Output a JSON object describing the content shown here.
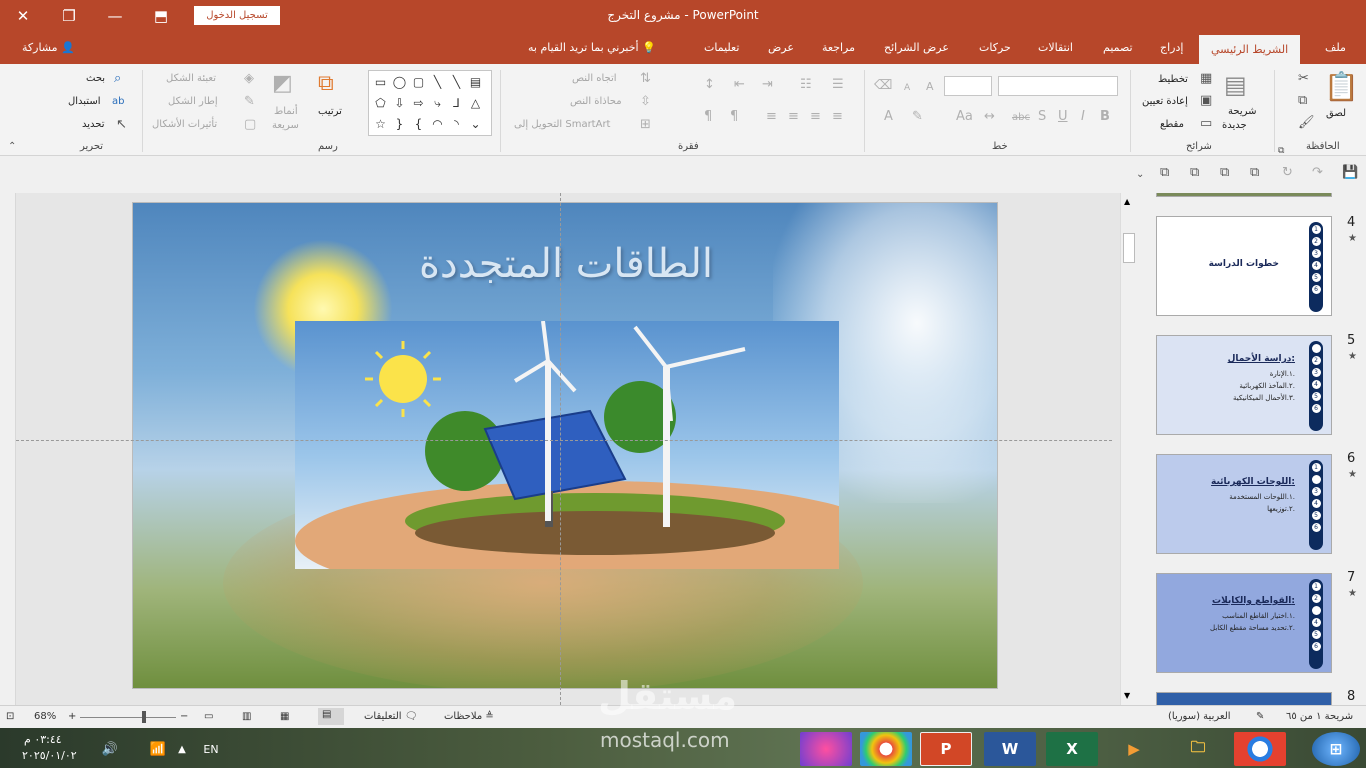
{
  "window": {
    "title": "مشروع التخرج  -  PowerPoint",
    "login_button": "تسجيل الدخول",
    "share": "مشاركة"
  },
  "tabs": [
    "ملف",
    "الشريط الرئيسي",
    "إدراج",
    "تصميم",
    "انتقالات",
    "حركات",
    "عرض الشرائح",
    "مراجعة",
    "عرض",
    "تعليمات"
  ],
  "tell_me": "أخبرني بما تريد القيام به",
  "ribbon": {
    "clipboard": {
      "label": "الحافظة",
      "paste": "لصق"
    },
    "slides": {
      "label": "شرائح",
      "new_slide": "شريحة",
      "new_slide2": "جديدة",
      "layout": "تخطيط",
      "reset": "إعادة تعيين",
      "section": "مقطع"
    },
    "font": {
      "label": "خط"
    },
    "paragraph": {
      "label": "فقرة",
      "text_direction": "اتجاه النص",
      "align_text": "محاذاة النص",
      "smartart": "التحويل إلى SmartArt"
    },
    "drawing": {
      "label": "رسم",
      "arrange": "ترتيب",
      "quick_styles": "أنماط",
      "quick_styles2": "سريعة",
      "shape_fill": "تعبئة الشكل",
      "shape_outline": "إطار الشكل",
      "shape_effects": "تأثيرات الأشكال"
    },
    "editing": {
      "label": "تحرير",
      "find": "بحث",
      "replace": "استبدال",
      "select": "تحديد"
    }
  },
  "slide": {
    "title": "الطاقات المتجددة"
  },
  "thumbnails": [
    {
      "num": "4",
      "title": "خطوات الدراسة",
      "items": []
    },
    {
      "num": "5",
      "title": "دراسة الأحمال:",
      "items": [
        "١.الإنارة.",
        "٢.المآخذ الكهربائية.",
        "٣.الأحمال الميكانيكية."
      ]
    },
    {
      "num": "6",
      "title": "اللوحات الكهربائية:",
      "items": [
        "١.اللوحات المستخدمة.",
        "٢.توزيعها."
      ]
    },
    {
      "num": "7",
      "title": "القواطع والكابلات:",
      "items": [
        "١.اختيار القاطع المناسب.",
        "٢.تحديد مساحة مقطع الكابل."
      ]
    },
    {
      "num": "8",
      "title": "",
      "items": []
    }
  ],
  "status": {
    "slide_of": "شريحة ١ من ٦٥",
    "language": "العربية (سوريا)",
    "notes": "ملاحظات",
    "comments": "التعليقات",
    "zoom": "68%"
  },
  "taskbar": {
    "time": "٠٣:٤٤ م",
    "date": "٢٠٢٥/٠١/٠٢",
    "lang": "EN"
  },
  "watermark": {
    "brand": "مستقل",
    "domain": "mostaql.com"
  },
  "colors": {
    "accent": "#b7472a",
    "thumb_dark": "#0d2b5e"
  }
}
